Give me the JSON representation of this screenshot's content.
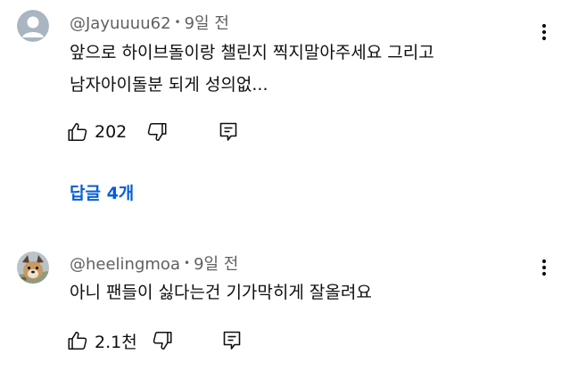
{
  "comments": [
    {
      "author": "@Jayuuuu62",
      "separator": "•",
      "time": "9일 전",
      "text_line1": "앞으로 하이브돌이랑 챌린지 찍지말아주세요 그리고",
      "text_line2": "남자아이돌분 되게  성의없...",
      "likes": "202",
      "replies_label": "답글 4개",
      "avatar_icon": "default-profile-icon"
    },
    {
      "author": "@heelingmoa",
      "separator": "•",
      "time": "9일 전",
      "text_line1": "아니 팬들이 싫다는건 기가막히게 잘올려요",
      "likes": "2.1천",
      "avatar_icon": "dog-photo-avatar"
    }
  ],
  "colors": {
    "link": "#065fd4",
    "secondary_text": "#606060",
    "primary_text": "#0f0f0f",
    "default_avatar": "#9aa7b4"
  }
}
